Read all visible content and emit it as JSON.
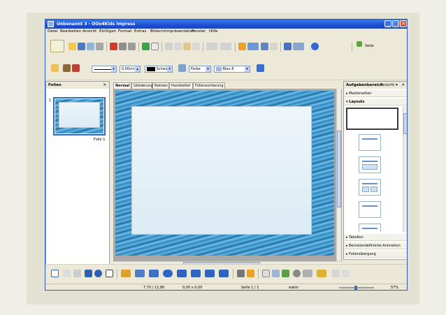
{
  "window": {
    "title": "Unbenannt 3 - OOo4Kids Impress",
    "controls": {
      "minimize": "_",
      "maximize": "□",
      "close": "✕"
    }
  },
  "menu": [
    "Datei",
    "Bearbeiten",
    "Ansicht",
    "Einfügen",
    "Format",
    "Extras",
    "Bildschirmpräsentation",
    "Fenster",
    "Hilfe"
  ],
  "toolbar_standard": {
    "slide_button_label": "Seite"
  },
  "toolbar_line": {
    "line_width": "0,00cm",
    "line_color": "Schwarz",
    "fill_type": "Farbe",
    "fill_color": "Blau 8"
  },
  "slides_panel": {
    "title": "Folien",
    "close": "✕",
    "slides": [
      {
        "number": "1",
        "label": "Folie 1"
      }
    ]
  },
  "view_tabs": [
    {
      "label": "Normal",
      "active": true
    },
    {
      "label": "Gliederung",
      "active": false
    },
    {
      "label": "Notizen",
      "active": false
    },
    {
      "label": "Handzettel",
      "active": false
    },
    {
      "label": "Foliensortierung",
      "active": false
    }
  ],
  "task_panel": {
    "title": "Aufgabenbereich",
    "view_label": "Ansicht",
    "close": "✕",
    "sections": {
      "master": "Masterseiten",
      "layouts": "Layouts",
      "tables": "Tabellen",
      "animation": "Benutzerdefinierte Animation",
      "transition": "Folienübergang"
    }
  },
  "status_bar": {
    "position": "7,70 / 12,86",
    "size": "0,00 x 0,00",
    "slide": "Seite 1 / 1",
    "master": "water",
    "zoom": "57%"
  },
  "colors": {
    "titlebar": "#1f4fd0",
    "accent_orange": "#f0a020",
    "selection_blue": "#316ac5"
  }
}
